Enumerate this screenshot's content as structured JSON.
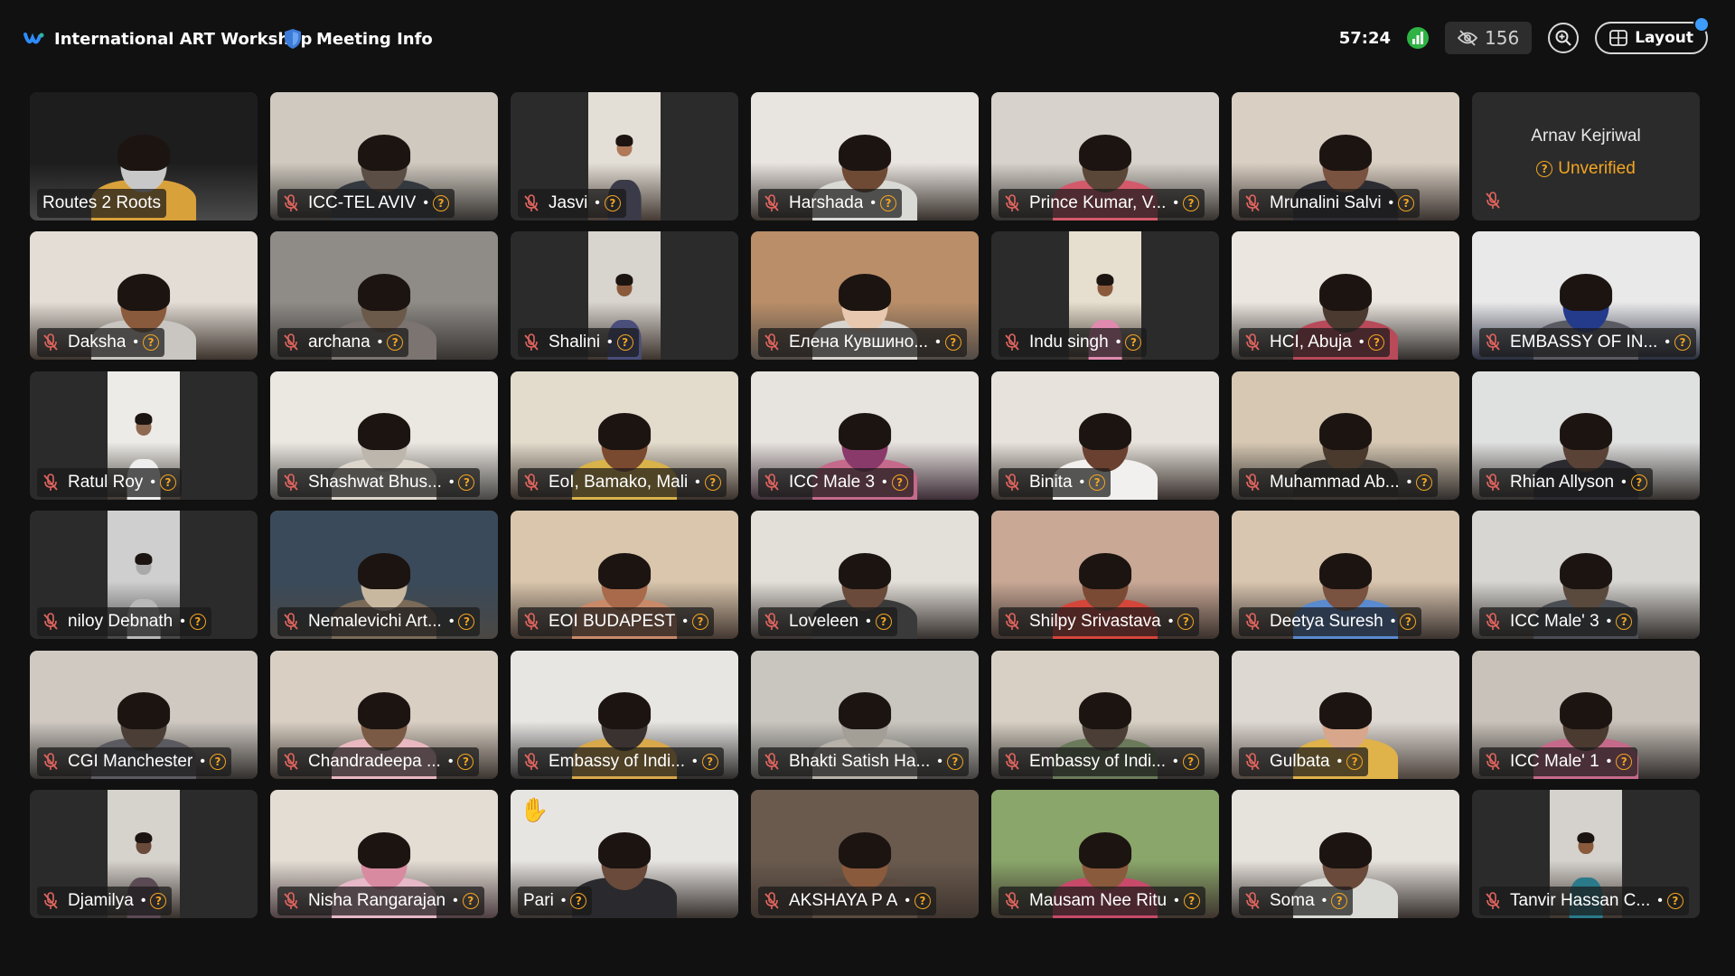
{
  "topbar": {
    "meeting_title": "International ART Workshop",
    "meeting_info_label": "Meeting Info",
    "timer": "57:24",
    "participants_count": "156",
    "layout_label": "Layout",
    "colors": {
      "brand_blue": "#2d8cff",
      "shield_blue": "#3d7bd9",
      "signal_green": "#2fb344",
      "warning_amber": "#f3a521"
    }
  },
  "tiles": [
    {
      "name": "Routes 2 Roots",
      "mic_off": false,
      "unverified": false,
      "video": true,
      "bg": "#1d1d1d",
      "accent": "#c8c8c8",
      "shirt": "#d9a13a"
    },
    {
      "name": "ICC-TEL AVIV",
      "mic_off": true,
      "unverified": true,
      "video": true,
      "bg": "#cfc9bf",
      "accent": "#5b4e44",
      "shirt": "#33393f"
    },
    {
      "name": "Jasvi",
      "mic_off": true,
      "unverified": true,
      "video": true,
      "portrait": true,
      "bg": "#e3dfd7",
      "accent": "#b07a5a",
      "shirt": "#3a3a48"
    },
    {
      "name": "Harshada",
      "mic_off": true,
      "unverified": true,
      "video": true,
      "bg": "#e8e4df",
      "accent": "#6e4a34",
      "shirt": "#d9d9d5"
    },
    {
      "name": "Prince Kumar, V...",
      "mic_off": true,
      "unverified": true,
      "video": true,
      "bg": "#d7d2cb",
      "accent": "#5a4738",
      "shirt": "#d35a6b"
    },
    {
      "name": "Mrunalini Salvi",
      "mic_off": true,
      "unverified": true,
      "video": true,
      "bg": "#d9cfc3",
      "accent": "#7a5240",
      "shirt": "#2c2c33"
    },
    {
      "name": "Arnav Kejriwal",
      "mic_off": true,
      "unverified": true,
      "video": false,
      "unverified_label": "Unverified"
    },
    {
      "name": "Daksha",
      "mic_off": true,
      "unverified": true,
      "video": true,
      "bg": "#e3ddd6",
      "accent": "#8a5a3c",
      "shirt": "#c9c6c2"
    },
    {
      "name": "archana",
      "mic_off": true,
      "unverified": true,
      "video": true,
      "bg": "#8f8c88",
      "accent": "#6b5a4a",
      "shirt": "#7b7470"
    },
    {
      "name": "Shalini",
      "mic_off": true,
      "unverified": true,
      "video": true,
      "portrait": true,
      "bg": "#d8d4ce",
      "accent": "#8a5a3c",
      "shirt": "#4a4e7a"
    },
    {
      "name": "Елена Кувшино...",
      "mic_off": true,
      "unverified": true,
      "video": true,
      "bg": "#b98e68",
      "accent": "#e8c9b0",
      "shirt": "#d8d4d0"
    },
    {
      "name": "Indu singh",
      "mic_off": true,
      "unverified": true,
      "video": true,
      "portrait": true,
      "bg": "#e6dfcf",
      "accent": "#8a5a3c",
      "shirt": "#e18ab0"
    },
    {
      "name": "HCI, Abuja",
      "mic_off": true,
      "unverified": true,
      "video": true,
      "bg": "#ebe6df",
      "accent": "#4a3a30",
      "shirt": "#b84a5a"
    },
    {
      "name": "EMBASSY OF IN...",
      "mic_off": true,
      "unverified": true,
      "video": true,
      "bg": "#e9e9ea",
      "accent": "#243a8a",
      "shirt": "#5a5a62"
    },
    {
      "name": "Ratul Roy",
      "mic_off": true,
      "unverified": true,
      "video": true,
      "portrait": true,
      "bg": "#ecebe7",
      "accent": "#8f6a52",
      "shirt": "#eeeeee"
    },
    {
      "name": "Shashwat Bhus...",
      "mic_off": true,
      "unverified": true,
      "video": true,
      "bg": "#ebe7e1",
      "accent": "#bdb6ad",
      "shirt": "#ddd6cc"
    },
    {
      "name": "EoI, Bamako, Mali",
      "mic_off": true,
      "unverified": true,
      "video": true,
      "bg": "#e3dbcc",
      "accent": "#7a4a30",
      "shirt": "#d9b24a"
    },
    {
      "name": "ICC Male 3",
      "mic_off": true,
      "unverified": true,
      "video": true,
      "bg": "#e7e3df",
      "accent": "#8a3a6a",
      "shirt": "#c56a8a"
    },
    {
      "name": "Binita",
      "mic_off": true,
      "unverified": true,
      "video": true,
      "bg": "#e7e3dc",
      "accent": "#6a4030",
      "shirt": "#f1f0ee"
    },
    {
      "name": "Muhammad Ab...",
      "mic_off": true,
      "unverified": true,
      "video": true,
      "bg": "#d6c8b3",
      "accent": "#4a3a2e",
      "shirt": "#3a3530"
    },
    {
      "name": "Rhian Allyson",
      "mic_off": true,
      "unverified": true,
      "video": true,
      "bg": "#dfe0e0",
      "accent": "#5a4336",
      "shirt": "#2a2a30"
    },
    {
      "name": "niloy Debnath",
      "mic_off": true,
      "unverified": true,
      "video": true,
      "portrait": true,
      "bg": "#cfcfcf",
      "accent": "#a9a9a9",
      "shirt": "#b8b8b8"
    },
    {
      "name": "Nemalevichi Art...",
      "mic_off": true,
      "unverified": true,
      "video": true,
      "bg": "#3a4a5a",
      "accent": "#c9b8a0",
      "shirt": "#7a6a58"
    },
    {
      "name": "EOI BUDAPEST",
      "mic_off": true,
      "unverified": true,
      "video": true,
      "bg": "#d9c6ad",
      "accent": "#a86a4a",
      "shirt": "#c98a6a"
    },
    {
      "name": "Loveleen",
      "mic_off": true,
      "unverified": true,
      "video": true,
      "bg": "#e3e0da",
      "accent": "#6a4a3a",
      "shirt": "#3a3a3a"
    },
    {
      "name": "Shilpy Srivastava",
      "mic_off": true,
      "unverified": true,
      "video": true,
      "bg": "#c9a896",
      "accent": "#7a4a34",
      "shirt": "#d5463a"
    },
    {
      "name": "Deetya Suresh",
      "mic_off": true,
      "unverified": true,
      "video": true,
      "bg": "#d9c6b0",
      "accent": "#7a5240",
      "shirt": "#5a8ad0"
    },
    {
      "name": "ICC Male' 3",
      "mic_off": true,
      "unverified": true,
      "video": true,
      "bg": "#d8d6d2",
      "accent": "#5a4a3e",
      "shirt": "#4a4e54"
    },
    {
      "name": "CGI Manchester",
      "mic_off": true,
      "unverified": true,
      "video": true,
      "bg": "#cfc9c2",
      "accent": "#4a3e36",
      "shirt": "#5a5a60"
    },
    {
      "name": "Chandradeepa ...",
      "mic_off": true,
      "unverified": true,
      "video": true,
      "bg": "#d9cfc3",
      "accent": "#7a5a44",
      "shirt": "#e9b8c0"
    },
    {
      "name": "Embassy of Indi...",
      "mic_off": true,
      "unverified": true,
      "video": true,
      "bg": "#e7e6e3",
      "accent": "#3a3230",
      "shirt": "#d9a84a"
    },
    {
      "name": "Bhakti Satish Ha...",
      "mic_off": true,
      "unverified": true,
      "video": true,
      "bg": "#c9c6c0",
      "accent": "#a39e96",
      "shirt": "#b6b1a9"
    },
    {
      "name": "Embassy of Indi...",
      "mic_off": true,
      "unverified": true,
      "video": true,
      "bg": "#d8d0c4",
      "accent": "#4a3e36",
      "shirt": "#6a7a5a"
    },
    {
      "name": "Gulbata",
      "mic_off": true,
      "unverified": true,
      "video": true,
      "bg": "#ded8d2",
      "accent": "#d8a68a",
      "shirt": "#e0b24a"
    },
    {
      "name": "ICC Male' 1",
      "mic_off": true,
      "unverified": true,
      "video": true,
      "bg": "#c9c2ba",
      "accent": "#4a3a30",
      "shirt": "#c56a8a"
    },
    {
      "name": "Djamilya",
      "mic_off": true,
      "unverified": true,
      "video": true,
      "portrait": true,
      "bg": "#d6d2cc",
      "accent": "#6a4a3a",
      "shirt": "#5a4a54"
    },
    {
      "name": "Nisha Rangarajan",
      "mic_off": true,
      "unverified": true,
      "video": true,
      "bg": "#e3ddd4",
      "accent": "#d88aa0",
      "shirt": "#e6b8c8"
    },
    {
      "name": "Pari",
      "mic_off": false,
      "unverified": true,
      "video": true,
      "hand": true,
      "bg": "#e7e5e2",
      "accent": "#6a4a3a",
      "shirt": "#2a2a2e"
    },
    {
      "name": "AKSHAYA P A",
      "mic_off": true,
      "unverified": true,
      "video": true,
      "bg": "#6a5a4e",
      "accent": "#8a5a3c",
      "shirt": "#5a4a40"
    },
    {
      "name": "Mausam Nee Ritu",
      "mic_off": true,
      "unverified": true,
      "video": true,
      "bg": "#8aa66a",
      "accent": "#8a5a3c",
      "shirt": "#c84a6a"
    },
    {
      "name": "Soma",
      "mic_off": true,
      "unverified": true,
      "video": true,
      "bg": "#e6e2dc",
      "accent": "#6a4a3a",
      "shirt": "#d9d9d5"
    },
    {
      "name": "Tanvir Hassan C...",
      "mic_off": true,
      "unverified": true,
      "video": true,
      "portrait": true,
      "bg": "#d5d2cd",
      "accent": "#8a5a3c",
      "shirt": "#2a7a8a"
    }
  ]
}
